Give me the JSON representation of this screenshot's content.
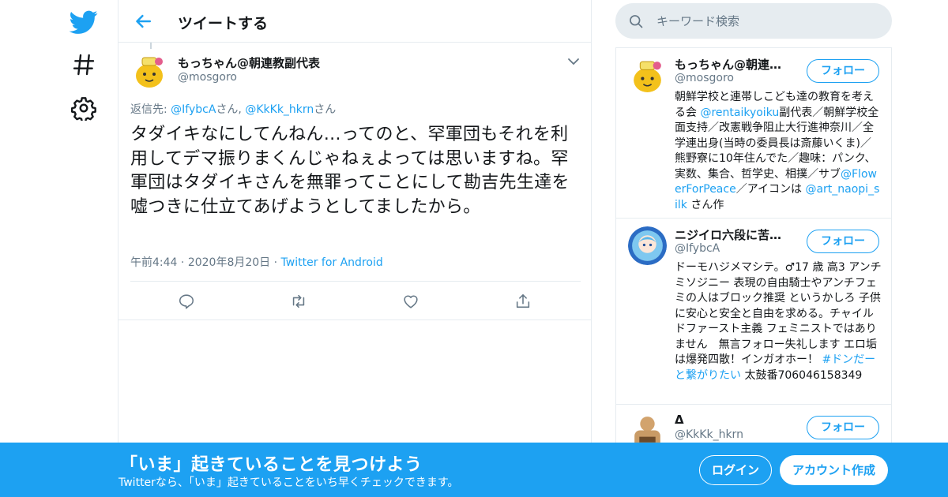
{
  "colors": {
    "accent": "#1da1f2",
    "secondary_text": "#657786",
    "border": "#e6ecf0"
  },
  "nav": {
    "icons": [
      "twitter-logo-icon",
      "hashtag-icon",
      "gear-icon"
    ]
  },
  "header": {
    "title": "ツイートする"
  },
  "tweet": {
    "author_name": "もっちゃん@朝連教副代表",
    "author_handle": "@mosgoro",
    "reply_label": "返信先: ",
    "reply_user1": "@IfybcA",
    "reply_sep": "さん, ",
    "reply_user2": "@KkKk_hkrn",
    "reply_suffix": "さん",
    "text": "タダイキなにしてんねん…ってのと、罕軍団もそれを利用してデマ振りまくんじゃねぇよっては思いますね。罕軍団はタダイキさんを無罪ってことにして勘吉先生達を嘘つきに仕立てあげようとしてましたから。",
    "time": "午前4:44",
    "dot": "·",
    "date": "2020年8月20日",
    "source": "Twitter for Android"
  },
  "search": {
    "placeholder": "キーワード検索"
  },
  "users": [
    {
      "name": "もっちゃん@朝連教副代表",
      "handle": "@mosgoro",
      "follow": "フォロー",
      "bio_parts": [
        "朝鮮学校と連帯しこども達の教育を考える会 ",
        "@rentaikyoiku",
        "副代表／朝鮮学校全面支持／改憲戦争阻止大行進神奈川／全学連出身(当時の委員長は斎藤いくま)／熊野寮に10年住んでた／趣味：パンク、実数、集合、哲学史、相撲／サブ",
        "@FlowerForPeace",
        "／アイコンは ",
        "@art_naopi_silk",
        " さん作"
      ]
    },
    {
      "name": "ニジイロ六段に苦戦中…",
      "handle": "@IfybcA",
      "follow": "フォロー",
      "bio_parts": [
        "ドーモハジメマシテ。♂17 歳 高3 アンチミソジニー 表現の自由騎士やアンチフェミの人はブロック推奨 というかしろ 子供に安心と安全と自由を求める。チャイルドファースト主義 フェミニストではありません　無言フォロー失礼します エロ垢は爆発四散！インガオホー！ ",
        "#ドンだーと繋がりたい",
        " 太鼓番706046158349"
      ]
    },
    {
      "name": "Δ",
      "handle": "@KkKk_hkrn",
      "follow": "フォロー"
    }
  ],
  "bottom_bar": {
    "title": "「いま」起きていることを見つけよう",
    "subtitle": "Twitterなら、「いま」起きていることをいち早くチェックできます。",
    "login": "ログイン",
    "signup": "アカウント作成"
  }
}
